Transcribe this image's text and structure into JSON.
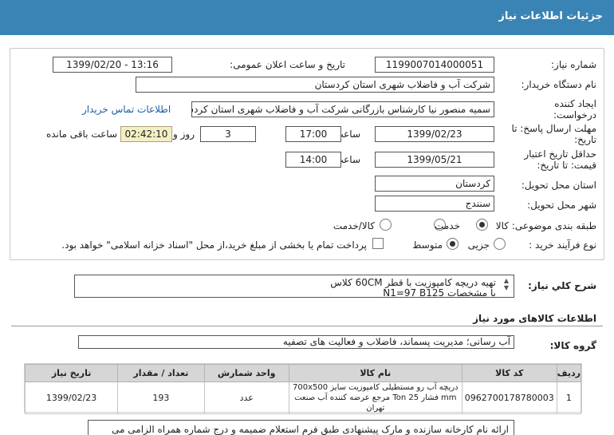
{
  "header": {
    "title": "جزئیات اطلاعات نیاز"
  },
  "form": {
    "need_number_label": "شماره نیاز:",
    "need_number": "1199007014000051",
    "announce_label": "تاریخ و ساعت اعلان عمومی:",
    "announce_value": "1399/02/20 - 13:16",
    "buyer_org_label": "نام دستگاه خریدار:",
    "buyer_org": "شرکت آب و فاضلاب شهری استان کردستان",
    "creator_label": "ایجاد کننده درخواست:",
    "creator": "سمیه منصور نیا کارشناس بازرگانی شرکت آب و فاضلاب شهری استان کردستان",
    "contact_link": "اطلاعات تماس خریدار",
    "deadline_label": "مهلت ارسال پاسخ: تا تاریخ:",
    "deadline_date": "1399/02/23",
    "time_label": "ساعت",
    "deadline_time": "17:00",
    "days_value": "3",
    "days_label": "روز و",
    "remaining_time": "02:42:10",
    "remaining_label": "ساعت باقی مانده",
    "validity_label": "حداقل تاریخ اعتبار قیمت: تا تاریخ:",
    "validity_date": "1399/05/21",
    "validity_time_label": "ساعت",
    "validity_time": "14:00",
    "province_label": "استان محل تحویل:",
    "province": "کردستان",
    "city_label": "شهر محل تحویل:",
    "city": "سنندج",
    "category_label": "طبقه بندی موضوعی:",
    "category_options": [
      "کالا",
      "خدمت",
      "کالا/خدمت"
    ],
    "process_label": "نوع فرآیند خرید :",
    "process_options": [
      "جزیی",
      "متوسط"
    ],
    "payment_note": "پرداخت تمام یا بخشی از مبلغ خرید،از محل \"اسناد خزانه اسلامی\" خواهد بود."
  },
  "summary": {
    "label": "شرح کلي نياز:",
    "line1": "تهیه دریچه کامپوزیت با قطر 60CM کلاس",
    "line2": "با مشخصات N1=97 B125"
  },
  "items_section": {
    "title": "اطلاعات کالاهای مورد نیاز",
    "group_label": "گروه کالا:",
    "group_value": "آب رسانی؛ مدیریت پسماند، فاضلاب و فعالیت های تصفیه"
  },
  "table": {
    "headers": [
      "ردیف",
      "کد کالا",
      "نام کالا",
      "واحد شمارش",
      "تعداد / مقدار",
      "تاریخ نیاز"
    ],
    "rows": [
      {
        "row": "1",
        "code": "0962700178780003",
        "name": "دریچه آب رو مستطیلی کامپوزیت سایز 700x500 mm فشار 25 Ton مرجع عرضه کننده آب صنعت تهران",
        "unit": "عدد",
        "qty": "193",
        "date": "1399/02/23"
      }
    ]
  },
  "note": {
    "text": "ارائه نام کارخانه سازنده و مارک پیشنهادی طبق فرم استعلام ضمیمه و درج شماره همراه الزامی می"
  }
}
